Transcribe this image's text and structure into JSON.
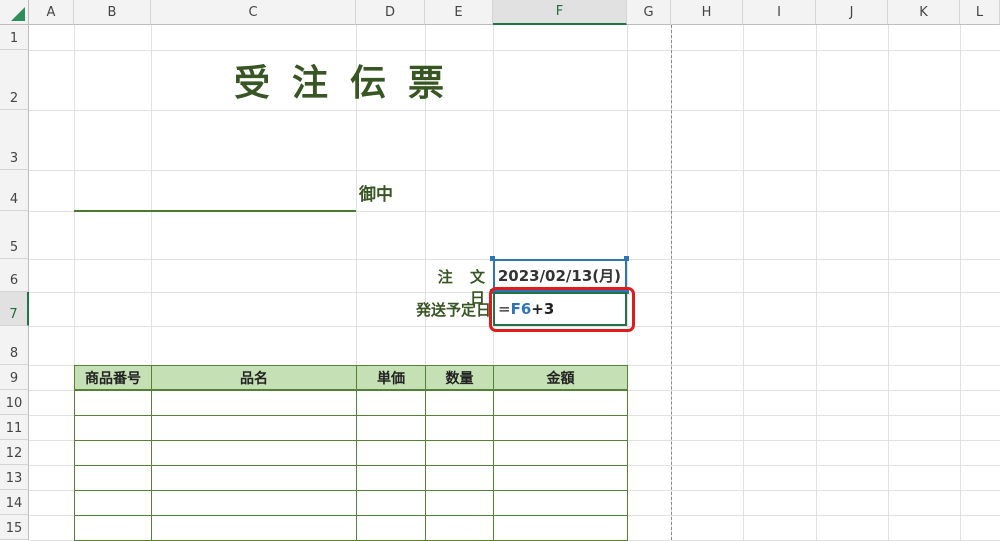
{
  "columns": [
    "A",
    "B",
    "C",
    "D",
    "E",
    "F",
    "G",
    "H",
    "I",
    "J",
    "K",
    "L"
  ],
  "rows": [
    "1",
    "2",
    "3",
    "4",
    "5",
    "6",
    "7",
    "8",
    "9",
    "10",
    "11",
    "12",
    "13",
    "14",
    "15"
  ],
  "selected_column": "F",
  "selected_row": "7",
  "form": {
    "title": "受注伝票",
    "addressee_suffix": "御中",
    "order_date_label": "注 文 日",
    "order_date_value": "2023/02/13(月)",
    "ship_date_label": "発送予定日",
    "formula": {
      "equals": "=",
      "ref": "F6",
      "rest": "+3"
    }
  },
  "table": {
    "headers": [
      "商品番号",
      "品名",
      "単価",
      "数量",
      "金額"
    ],
    "row_count": 6
  },
  "colors": {
    "accent_green": "#375623",
    "header_fill": "#c5e0b4",
    "table_border": "#538135",
    "reference_blue": "#2e75b6",
    "highlight_red": "#e01b1b"
  }
}
